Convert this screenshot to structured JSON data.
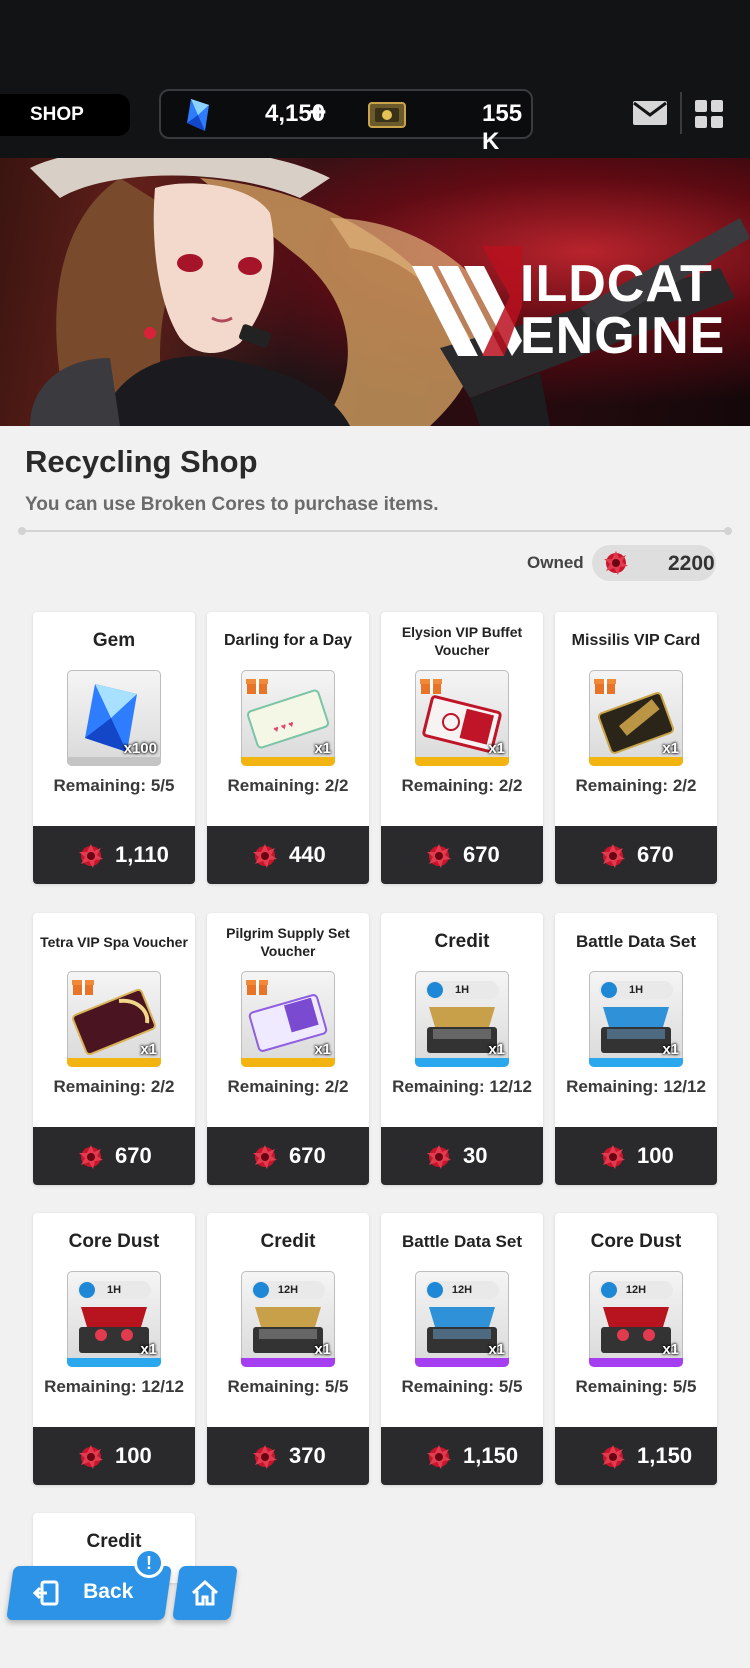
{
  "header": {
    "section_label": "SHOP",
    "gems": "4,150",
    "plus_label": "+",
    "credits": "155 K",
    "icons": [
      "gem-icon",
      "credit-icon",
      "mail-icon",
      "menu-icon"
    ]
  },
  "banner": {
    "logo_line1": "ILDCAT",
    "logo_line2": "ENGINE"
  },
  "shop": {
    "title": "Recycling Shop",
    "subtitle": "You can use Broken Cores to purchase items.",
    "owned_label": "Owned",
    "owned_value": "2200"
  },
  "colors": {
    "price_bar": "#2a2a2c",
    "accent_blue": "#2d93e6",
    "rarity_gold": "#f2b410",
    "rarity_blue": "#2ba7ee",
    "rarity_purple": "#a53ef0",
    "core_red": "#c8152c"
  },
  "items": [
    {
      "name": "Gem",
      "qty": "x100",
      "remaining": "Remaining: 5/5",
      "price": "1,110",
      "time": ""
    },
    {
      "name": "Darling for a Day",
      "qty": "x1",
      "remaining": "Remaining: 2/2",
      "price": "440",
      "time": ""
    },
    {
      "name": "Elysion VIP Buffet Voucher",
      "qty": "x1",
      "remaining": "Remaining: 2/2",
      "price": "670",
      "time": ""
    },
    {
      "name": "Missilis VIP Card",
      "qty": "x1",
      "remaining": "Remaining: 2/2",
      "price": "670",
      "time": ""
    },
    {
      "name": "Tetra VIP Spa Voucher",
      "qty": "x1",
      "remaining": "Remaining: 2/2",
      "price": "670",
      "time": ""
    },
    {
      "name": "Pilgrim Supply Set Voucher",
      "qty": "x1",
      "remaining": "Remaining: 2/2",
      "price": "670",
      "time": ""
    },
    {
      "name": "Credit",
      "qty": "x1",
      "remaining": "Remaining: 12/12",
      "price": "30",
      "time": "1H"
    },
    {
      "name": "Battle Data Set",
      "qty": "x1",
      "remaining": "Remaining: 12/12",
      "price": "100",
      "time": "1H"
    },
    {
      "name": "Core Dust",
      "qty": "x1",
      "remaining": "Remaining: 12/12",
      "price": "100",
      "time": "1H"
    },
    {
      "name": "Credit",
      "qty": "x1",
      "remaining": "Remaining: 5/5",
      "price": "370",
      "time": "12H"
    },
    {
      "name": "Battle Data Set",
      "qty": "x1",
      "remaining": "Remaining: 5/5",
      "price": "1,150",
      "time": "12H"
    },
    {
      "name": "Core Dust",
      "qty": "x1",
      "remaining": "Remaining: 5/5",
      "price": "1,150",
      "time": "12H"
    },
    {
      "name": "Credit"
    }
  ],
  "nav": {
    "back_label": "Back",
    "alert_badge": "!"
  }
}
